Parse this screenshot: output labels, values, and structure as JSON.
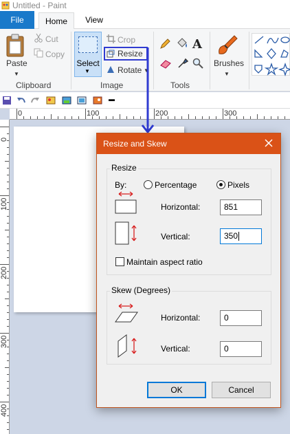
{
  "window": {
    "title": "Untitled - Paint",
    "icon": "paint-app-icon"
  },
  "tabs": {
    "file": "File",
    "home": "Home",
    "view": "View"
  },
  "ribbon": {
    "clipboard": {
      "paste": "Paste",
      "cut": "Cut",
      "copy": "Copy",
      "label": "Clipboard"
    },
    "image": {
      "select": "Select",
      "crop": "Crop",
      "resize": "Resize",
      "rotate": "Rotate",
      "label": "Image"
    },
    "tools": {
      "label": "Tools",
      "icons": [
        "pencil-icon",
        "fill-icon",
        "text-icon",
        "eraser-icon",
        "color-picker-icon",
        "magnifier-icon"
      ]
    },
    "brushes": {
      "label": "Brushes"
    }
  },
  "rulers": {
    "top": [
      "0",
      "100",
      "200",
      "300"
    ],
    "left": [
      "0",
      "100",
      "200",
      "300",
      "400"
    ]
  },
  "dialog": {
    "title": "Resize and Skew",
    "resize": {
      "legend": "Resize",
      "by_label": "By:",
      "percentage_label": "Percentage",
      "pixels_label": "Pixels",
      "selected": "Pixels",
      "horizontal_label": "Horizontal:",
      "horizontal_value": "851",
      "vertical_label": "Vertical:",
      "vertical_value": "350",
      "aspect_label": "Maintain aspect ratio",
      "aspect_checked": false
    },
    "skew": {
      "legend": "Skew (Degrees)",
      "horizontal_label": "Horizontal:",
      "horizontal_value": "0",
      "vertical_label": "Vertical:",
      "vertical_value": "0"
    },
    "ok": "OK",
    "cancel": "Cancel"
  },
  "colors": {
    "accent": "#1979ca",
    "dialog_title": "#da5217",
    "annotation": "#2f3bd1",
    "arrow_red": "#d81e1e"
  }
}
